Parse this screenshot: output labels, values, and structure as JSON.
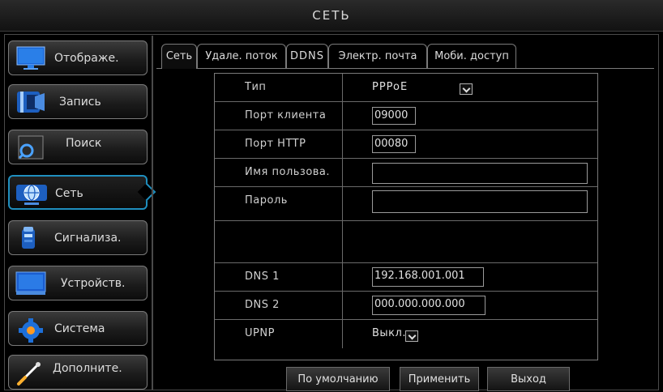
{
  "window": {
    "title": "СЕТЬ"
  },
  "sidebar": {
    "items": [
      {
        "label": "Отображе.",
        "icon": "monitor-icon"
      },
      {
        "label": "Запись",
        "icon": "film-icon"
      },
      {
        "label": "Поиск",
        "icon": "search-icon"
      },
      {
        "label": "Сеть",
        "icon": "globe-icon",
        "active": true
      },
      {
        "label": "Сигнализа.",
        "icon": "alarm-icon"
      },
      {
        "label": "Устройств.",
        "icon": "device-icon"
      },
      {
        "label": "Система",
        "icon": "gear-icon"
      },
      {
        "label": "Дополните.",
        "icon": "wrench-icon"
      }
    ]
  },
  "tabs": [
    {
      "label": "Сеть",
      "active": true
    },
    {
      "label": "Удале. поток"
    },
    {
      "label": "DDNS"
    },
    {
      "label": "Электр. почта"
    },
    {
      "label": "Моби. доступ"
    }
  ],
  "form": {
    "type_label": "Тип",
    "type_value": "PPPoE",
    "client_port_label": "Порт клиента",
    "client_port_value": "09000",
    "http_port_label": "Порт HTTP",
    "http_port_value": "00080",
    "username_label": "Имя пользова.",
    "username_value": "",
    "password_label": "Пароль",
    "password_value": "",
    "dns1_label": "DNS 1",
    "dns1_value": "192.168.001.001",
    "dns2_label": "DNS 2",
    "dns2_value": "000.000.000.000",
    "upnp_label": "UPNP",
    "upnp_value": "Выкл."
  },
  "buttons": {
    "default_label": "По умолчанию",
    "apply_label": "Применить",
    "exit_label": "Выход"
  },
  "colors": {
    "accent": "#1f8fbf",
    "background": "#000000",
    "border": "#7a7a7a"
  }
}
